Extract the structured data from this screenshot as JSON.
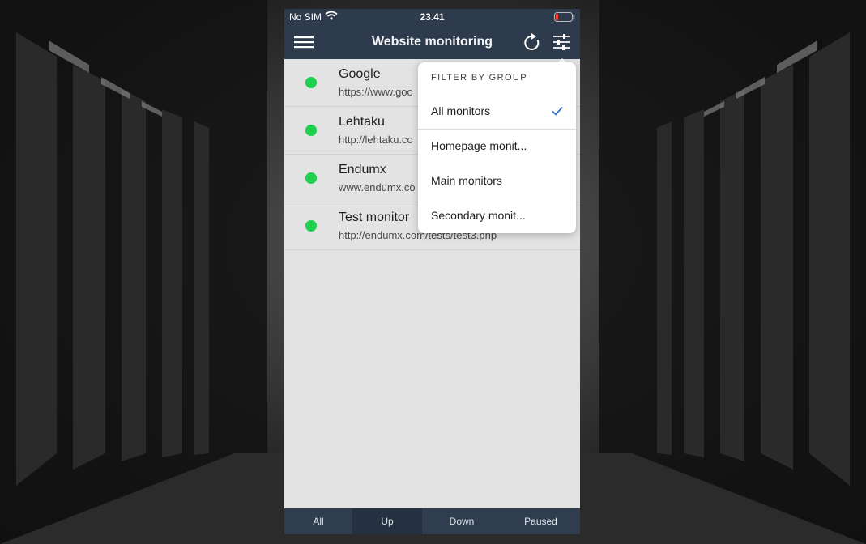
{
  "status_bar": {
    "carrier": "No SIM",
    "time": "23.41",
    "wifi_icon": "wifi-icon",
    "battery_icon": "battery-low-icon"
  },
  "nav": {
    "title": "Website monitoring",
    "menu_icon": "hamburger-menu-icon",
    "refresh_icon": "refresh-icon",
    "filter_icon": "sliders-filter-icon"
  },
  "monitors": [
    {
      "name": "Google",
      "url": "https://www.goo",
      "status": "up"
    },
    {
      "name": "Lehtaku",
      "url": "http://lehtaku.co",
      "status": "up"
    },
    {
      "name": "Endumx",
      "url": "www.endumx.co",
      "status": "up"
    },
    {
      "name": "Test monitor",
      "url": "http://endumx.com/tests/test3.php",
      "status": "up"
    }
  ],
  "filter_menu": {
    "header": "FILTER BY GROUP",
    "items": [
      {
        "label": "All monitors",
        "selected": true
      },
      {
        "label": "Homepage monit...",
        "selected": false
      },
      {
        "label": "Main monitors",
        "selected": false
      },
      {
        "label": "Secondary monit...",
        "selected": false
      }
    ]
  },
  "tabs": [
    {
      "label": "All",
      "active": false
    },
    {
      "label": "Up",
      "active": true
    },
    {
      "label": "Down",
      "active": false
    },
    {
      "label": "Paused",
      "active": false
    }
  ],
  "colors": {
    "nav_bg": "#2e3b4d",
    "status_up": "#1fcf4e",
    "check_accent": "#2f6fd6",
    "list_bg": "#e3e3e3"
  }
}
